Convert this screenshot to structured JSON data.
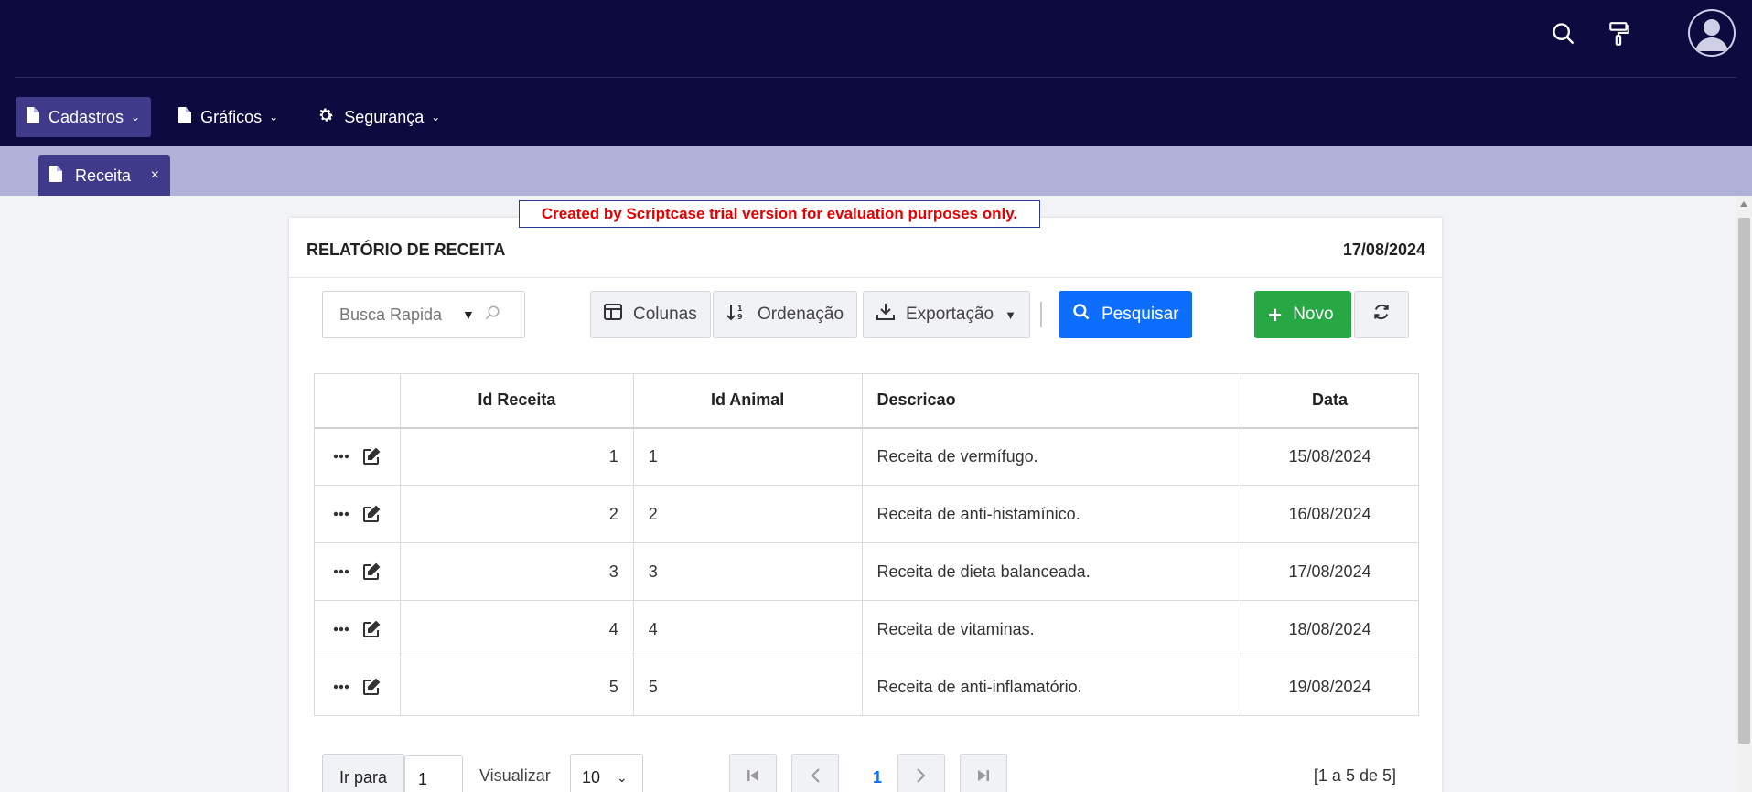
{
  "header": {
    "icons": [
      "search-icon",
      "paint-roller-icon",
      "user-avatar-icon"
    ]
  },
  "menu": {
    "items": [
      {
        "label": "Cadastros",
        "icon": "file-icon",
        "active": true
      },
      {
        "label": "Gráficos",
        "icon": "file-icon",
        "active": false
      },
      {
        "label": "Segurança",
        "icon": "gear-icon",
        "active": false
      }
    ]
  },
  "tab": {
    "label": "Receita",
    "close": "×"
  },
  "trial_notice": "Created by Scriptcase trial version for evaluation purposes only.",
  "report": {
    "title": "RELATÓRIO DE RECEITA",
    "date": "17/08/2024"
  },
  "toolbar": {
    "search_placeholder": "Busca Rapida",
    "columns_label": "Colunas",
    "sort_label": "Ordenação",
    "export_label": "Exportação",
    "search_button_label": "Pesquisar",
    "new_label": "Novo"
  },
  "table": {
    "headers": [
      "",
      "Id Receita",
      "Id Animal",
      "Descricao",
      "Data"
    ],
    "rows": [
      {
        "id_receita": "1",
        "id_animal": "1",
        "descricao": "Receita de vermífugo.",
        "data": "15/08/2024"
      },
      {
        "id_receita": "2",
        "id_animal": "2",
        "descricao": "Receita de anti-histamínico.",
        "data": "16/08/2024"
      },
      {
        "id_receita": "3",
        "id_animal": "3",
        "descricao": "Receita de dieta balanceada.",
        "data": "17/08/2024"
      },
      {
        "id_receita": "4",
        "id_animal": "4",
        "descricao": "Receita de vitaminas.",
        "data": "18/08/2024"
      },
      {
        "id_receita": "5",
        "id_animal": "5",
        "descricao": "Receita de anti-inflamatório.",
        "data": "19/08/2024"
      }
    ]
  },
  "pager": {
    "goto_label": "Ir para",
    "goto_value": "1",
    "view_label": "Visualizar",
    "view_value": "10",
    "current_page": "1",
    "summary": "[1 a 5 de 5]"
  }
}
